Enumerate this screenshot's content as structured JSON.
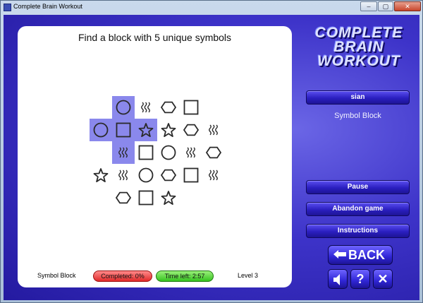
{
  "window": {
    "title": "Complete Brain Workout",
    "minimize_label": "–",
    "maximize_label": "▢",
    "close_label": "✕"
  },
  "game": {
    "instruction": "Find a block with 5 unique symbols",
    "board": {
      "rows": [
        [
          "empty",
          "circle",
          "waves",
          "hexagon",
          "square"
        ],
        [
          "circle",
          "square",
          "star",
          "star",
          "hexagon",
          "waves"
        ],
        [
          "empty",
          "waves",
          "square",
          "circle",
          "waves",
          "hexagon"
        ],
        [
          "star",
          "waves",
          "circle",
          "hexagon",
          "square",
          "waves"
        ],
        [
          "empty",
          "hexagon",
          "square",
          "star",
          "empty",
          "empty"
        ]
      ],
      "selected": [
        [
          0,
          1
        ],
        [
          1,
          0
        ],
        [
          1,
          1
        ],
        [
          1,
          2
        ],
        [
          2,
          1
        ]
      ]
    },
    "status": {
      "mode": "Symbol Block",
      "completed": "Completed: 0%",
      "time_left": "Time left: 2:57",
      "level": "Level 3"
    }
  },
  "sidebar": {
    "logo_line1": "COMPLETE",
    "logo_line2": "BRAIN",
    "logo_line3": "WORKOUT",
    "player": "sian",
    "game_name": "Symbol Block",
    "pause": "Pause",
    "abandon": "Abandon game",
    "instructions": "Instructions",
    "back": "BACK",
    "help_glyph": "?",
    "close_glyph": "✕"
  },
  "colors": {
    "accent": "#2b1fc0",
    "selection": "#8a88ec",
    "completed_bar": "#e02a2a",
    "time_bar": "#35c21f"
  }
}
